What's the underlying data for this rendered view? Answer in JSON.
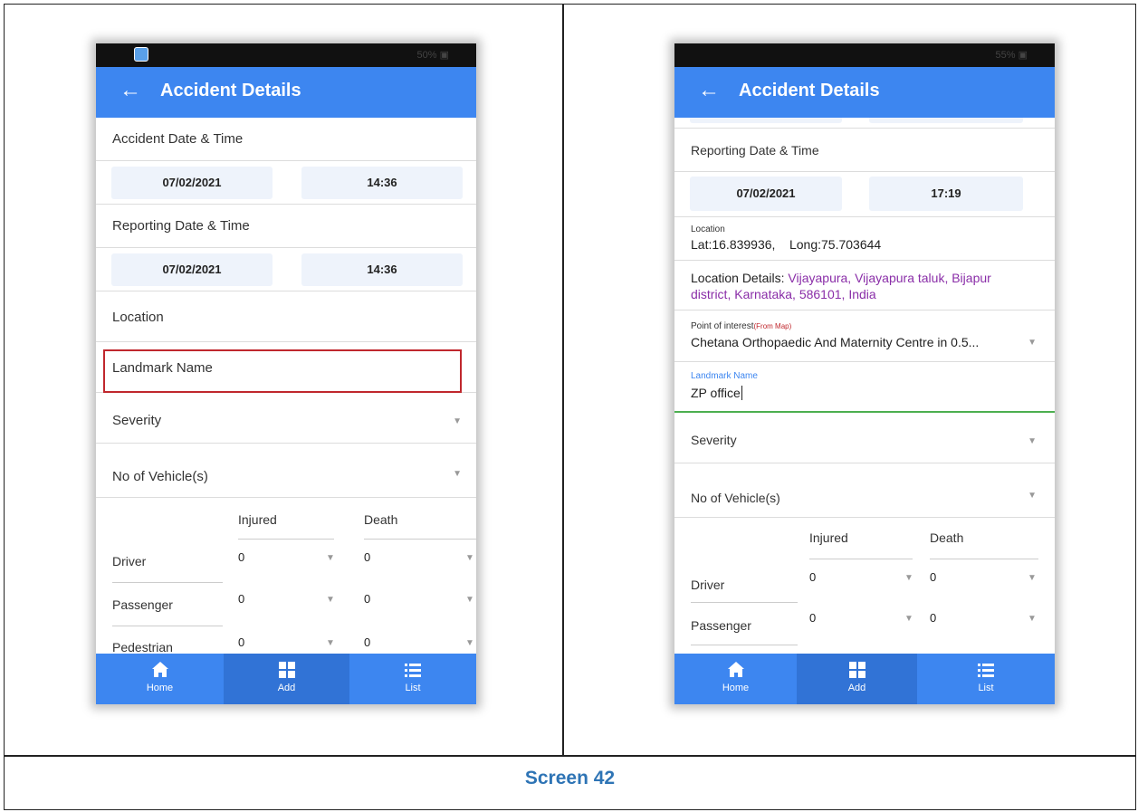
{
  "caption": "Screen 42",
  "phone_left": {
    "status_battery": "50% ▣",
    "title": "Accident Details",
    "accident_dt": {
      "label": "Accident Date & Time",
      "date": "07/02/2021",
      "time": "14:36"
    },
    "reporting_dt": {
      "label": "Reporting Date & Time",
      "date": "07/02/2021",
      "time": "14:36"
    },
    "location_label": "Location",
    "landmark_label": "Landmark Name",
    "severity_label": "Severity",
    "vehicles_label": "No of Vehicle(s)",
    "table": {
      "col_injured": "Injured",
      "col_death": "Death",
      "rows": [
        {
          "label": "Driver",
          "injured": "0",
          "death": "0"
        },
        {
          "label": "Passenger",
          "injured": "0",
          "death": "0"
        },
        {
          "label": "Pedestrian",
          "injured": "0",
          "death": "0"
        }
      ]
    },
    "nav": {
      "home": "Home",
      "add": "Add",
      "list": "List"
    }
  },
  "phone_right": {
    "status_battery": "55% ▣",
    "title": "Accident Details",
    "reporting_dt": {
      "label": "Reporting Date & Time",
      "date": "07/02/2021",
      "time": "17:19"
    },
    "location_small": "Location",
    "latlong_lat": "Lat:16.839936,",
    "latlong_long": "Long:75.703644",
    "location_details_label": "Location Details: ",
    "location_details_value_1": "Vijayapura, Vijayapura taluk, Bijapur",
    "location_details_value_2": "district, Karnataka, 586101, India",
    "poi_label": "Point of interest",
    "poi_from": "(From Map)",
    "poi_value": "Chetana Orthopaedic And Maternity Centre in 0.5...",
    "landmark_label": "Landmark Name",
    "landmark_value": "ZP office",
    "severity_label": "Severity",
    "vehicles_label": "No of Vehicle(s)",
    "table": {
      "col_injured": "Injured",
      "col_death": "Death",
      "rows": [
        {
          "label": "Driver",
          "injured": "0",
          "death": "0"
        },
        {
          "label": "Passenger",
          "injured": "0",
          "death": "0"
        }
      ]
    },
    "nav": {
      "home": "Home",
      "add": "Add",
      "list": "List"
    }
  }
}
